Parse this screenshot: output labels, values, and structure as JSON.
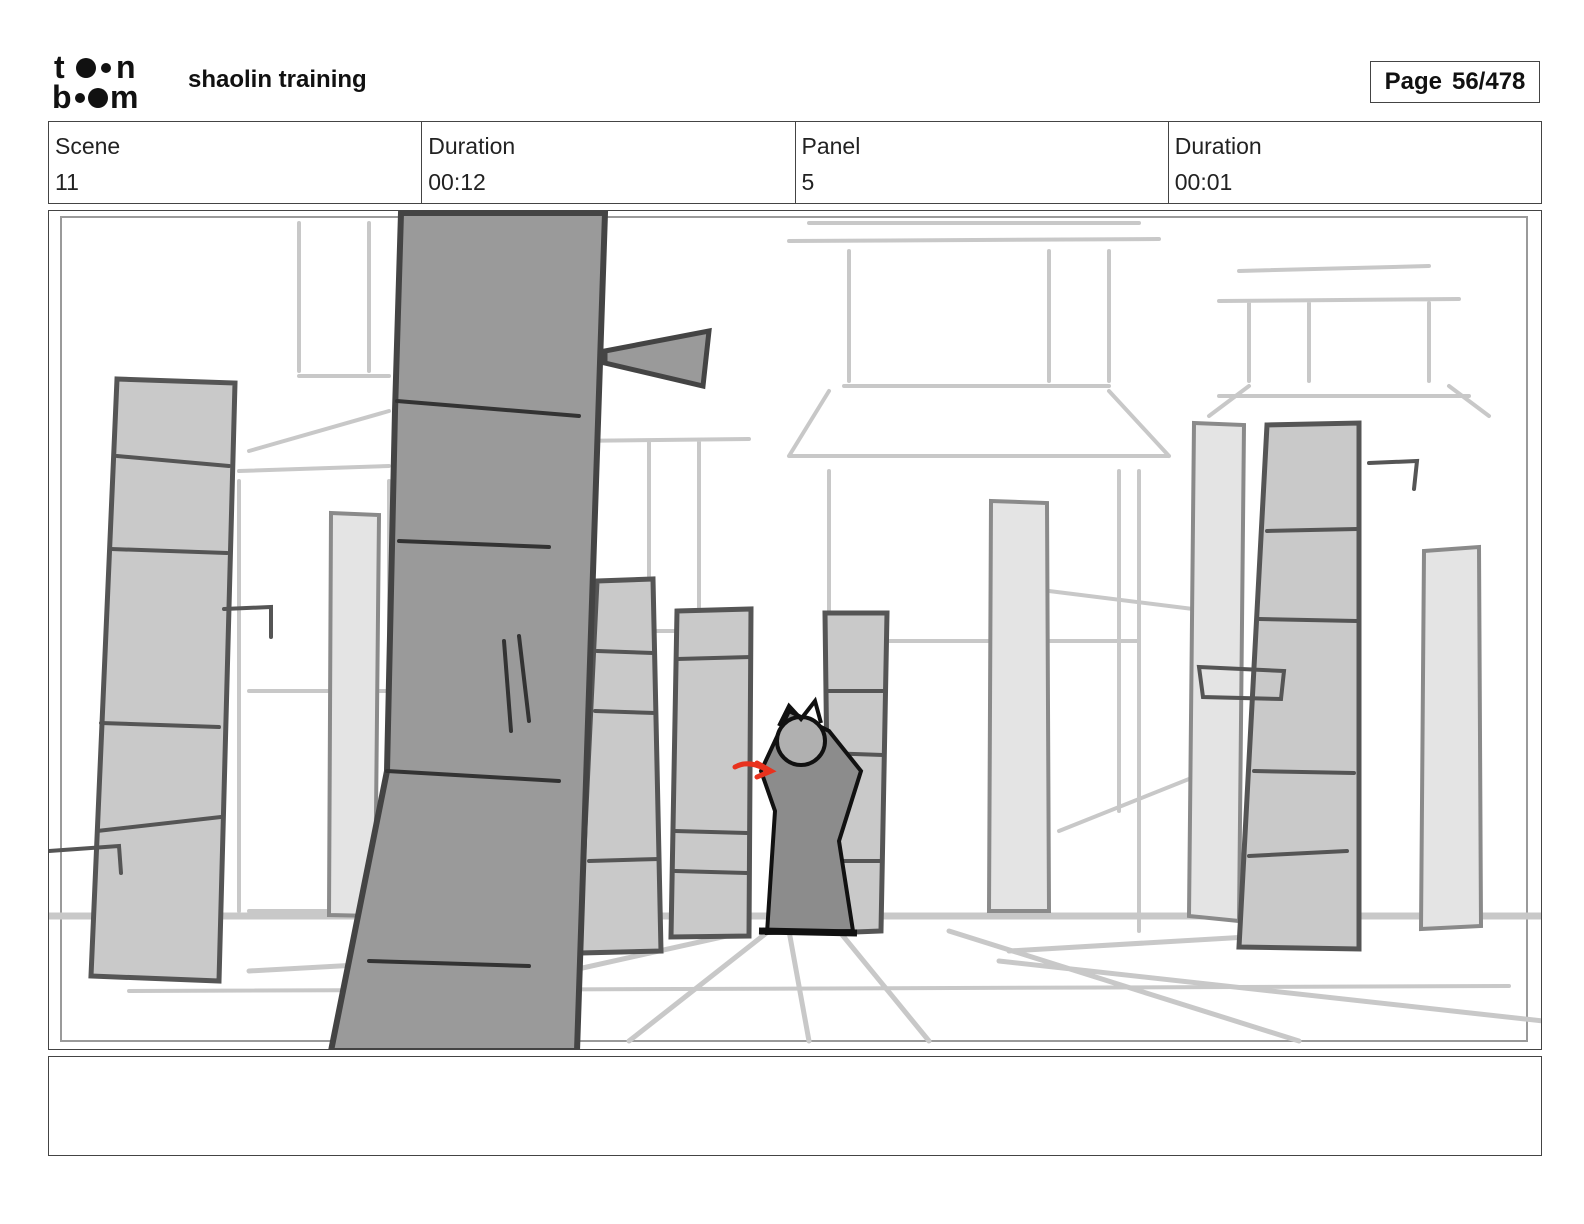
{
  "header": {
    "logo_text": "toon boom",
    "project_title": "shaolin training",
    "page_label": "Page",
    "page_number": "56/478"
  },
  "info": {
    "scene_label": "Scene",
    "scene_value": "11",
    "scene_duration_label": "Duration",
    "scene_duration_value": "00:12",
    "panel_label": "Panel",
    "panel_value": "5",
    "panel_duration_label": "Duration",
    "panel_duration_value": "00:01"
  },
  "notes": {
    "text": ""
  },
  "colors": {
    "ink": "#3a3a3a",
    "dark_fill": "#9a9a9a",
    "mid_fill": "#c6c6c6",
    "light_fill": "#e6e6e6",
    "sketch_line": "#c8c8c8",
    "action_arrow": "#e8321e"
  }
}
